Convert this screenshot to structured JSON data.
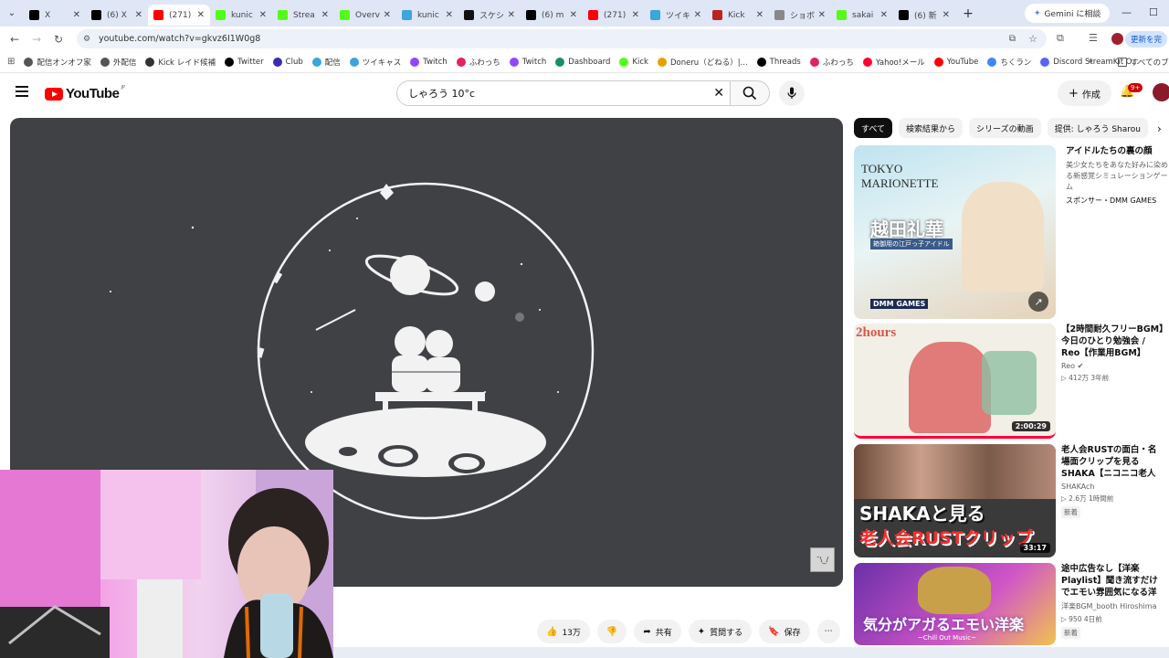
{
  "browser": {
    "tabs": [
      {
        "title": "X",
        "icon": "x-icon",
        "color": "#000000"
      },
      {
        "title": "(6) X",
        "icon": "x-icon",
        "color": "#000000"
      },
      {
        "title": "(271)",
        "icon": "youtube-icon",
        "color": "#ff0000",
        "active": true
      },
      {
        "title": "kunic",
        "icon": "kick-icon",
        "color": "#53fc18"
      },
      {
        "title": "Strea",
        "icon": "kick-icon",
        "color": "#53fc18"
      },
      {
        "title": "Overv",
        "icon": "kick-icon",
        "color": "#53fc18"
      },
      {
        "title": "kunic",
        "icon": "streamkit-icon",
        "color": "#3ba5dc"
      },
      {
        "title": "スケシ",
        "icon": "dot-icon",
        "color": "#111111"
      },
      {
        "title": "(6) m",
        "icon": "x-icon",
        "color": "#000000"
      },
      {
        "title": "(271)",
        "icon": "youtube-icon",
        "color": "#ff0000"
      },
      {
        "title": "ツイキ",
        "icon": "twicas-icon",
        "color": "#3ba5dc"
      },
      {
        "title": "Kick",
        "icon": "kick-icon",
        "color": "#b22"
      },
      {
        "title": "ショボ",
        "icon": "shobo-icon",
        "color": "#888888"
      },
      {
        "title": "sakai",
        "icon": "kick-icon",
        "color": "#53fc18"
      },
      {
        "title": "(6) 新",
        "icon": "x-icon",
        "color": "#000000"
      }
    ],
    "gemini": "Gemini に相談",
    "url": "youtube.com/watch?v=gkvz6I1W0g8",
    "update": "更新を完",
    "bookmarks": [
      {
        "label": "配信オンオフ家",
        "color": "#555555"
      },
      {
        "label": "外配信",
        "color": "#555555"
      },
      {
        "label": "Kick レイド候補",
        "color": "#333333"
      },
      {
        "label": "Twitter",
        "color": "#000000"
      },
      {
        "label": "Club",
        "color": "#3a2cb5"
      },
      {
        "label": "配信",
        "color": "#3ba5dc"
      },
      {
        "label": "ツイキャス",
        "color": "#3ba5dc"
      },
      {
        "label": "Twitch",
        "color": "#9146ff"
      },
      {
        "label": "ふわっち",
        "color": "#e0245e"
      },
      {
        "label": "Twitch",
        "color": "#9146ff"
      },
      {
        "label": "Dashboard",
        "color": "#1d8c6b"
      },
      {
        "label": "Kick",
        "color": "#53fc18"
      },
      {
        "label": "Doneru（どねる）|...",
        "color": "#e8a000"
      },
      {
        "label": "Threads",
        "color": "#000000"
      },
      {
        "label": "ふわっち",
        "color": "#e0245e"
      },
      {
        "label": "Yahoo!メール",
        "color": "#ff0033"
      },
      {
        "label": "YouTube",
        "color": "#ff0000"
      },
      {
        "label": "ちくラン",
        "color": "#4285f4"
      },
      {
        "label": "Discord StreamKit O...",
        "color": "#5865f2"
      }
    ],
    "all_bookmarks": "すべてのブッ"
  },
  "youtube": {
    "search_query": "しゃろう 10°c",
    "create_label": "作成",
    "notif_badge": "9+",
    "actions": {
      "likes": "13万",
      "share": "共有",
      "ask": "質問する",
      "save": "保存"
    },
    "chips": [
      "すべて",
      "検索結果から",
      "シリーズの動画",
      "提供: しゃろう Sharou"
    ],
    "recs": [
      {
        "title": "アイドルたちの裏の顔",
        "desc": "美少女たちをあなた好みに染める新感覚シミュレーションゲーム",
        "channel": "スポンサー・DMM GAMES",
        "thumb_text": "越田礼華",
        "thumb_sub": "TOKYO MARIONETTE",
        "thumb_caption": "箱御用の江戸っ子アイドル",
        "brand": "DMM GAMES"
      },
      {
        "title": "【2時間耐久フリーBGM】今日のひとり勉強会 / Reo【作業用BGM】",
        "channel": "Reo",
        "meta": "412万 3年前",
        "duration": "2:00:29",
        "thumb_text": "2hours"
      },
      {
        "title": "老人会RUSTの面白・名場面クリップを見るSHAKA【ニコニコ老人会RUST】",
        "channel": "SHAKAch",
        "meta": "2.6万 1時間前",
        "badge": "新着",
        "duration": "33:17",
        "thumb_text": "SHAKAと見る",
        "thumb_text2": "老人会RUSTクリップ"
      },
      {
        "title": "途中広告なし【洋楽Playlist】聞き流すだけでエモい雰囲気になる洋楽BGM｜...",
        "channel": "洋楽BGM_booth Hiroshima",
        "meta": "950 4日前",
        "badge": "新着",
        "thumb_text": "気分がアガるエモい洋楽",
        "thumb_sub": "~Chill Out Music~"
      }
    ]
  }
}
